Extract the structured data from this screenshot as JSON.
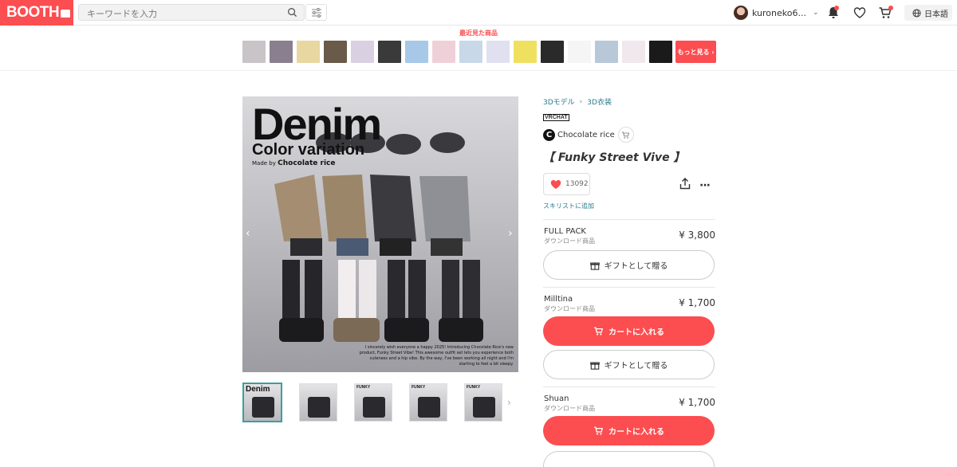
{
  "header": {
    "logo": "BOOTH",
    "search_placeholder": "キーワードを入力",
    "username": "kuroneko6...",
    "language": "日本語"
  },
  "recent": {
    "title": "最近見た商品",
    "more_label": "もっと見る ›",
    "thumb_colors": [
      "#c9c4c8",
      "#8a7f8f",
      "#e8d7a0",
      "#6a5a4a",
      "#d9d0e2",
      "#3a3a3a",
      "#a8c8e8",
      "#f0d0d8",
      "#c8d8e8",
      "#e0e0f0",
      "#f0e060",
      "#2a2a2a",
      "#f5f5f5",
      "#b8c8d8",
      "#f0e8ec",
      "#1a1a1a"
    ]
  },
  "product": {
    "image_title": "Denim",
    "image_subtitle": "Color variation",
    "made_by_prefix": "Made by",
    "made_by_name": "Chocolate rice",
    "image_desc": "I sincerely wish everyone a happy 2025! Introducing Chocolate Rice's new product, Funky Street Vibe! This awesome outfit set lets you experience both cuteness and a hip vibe. By the way, I've been working all night and I'm starting to feel a bit sleepy.",
    "thumb_labels": [
      "Denim",
      "",
      "FUNKY",
      "FUNKY",
      "FUNKY"
    ],
    "breadcrumbs": [
      "3Dモデル",
      "3D衣装"
    ],
    "platform_badge": "VRCHAT",
    "shop_name": "Chocolate rice",
    "title": "【 Funky Street Vive 】",
    "likes": "13092",
    "wishlist_label": "スキリストに追加"
  },
  "variants": [
    {
      "name": "FULL PACK",
      "type": "ダウンロード商品",
      "price": "¥ 3,800",
      "gift_label": "ギフトとして贈る"
    },
    {
      "name": "Milltina",
      "type": "ダウンロード商品",
      "price": "¥ 1,700",
      "cart_label": "カートに入れる",
      "gift_label": "ギフトとして贈る"
    },
    {
      "name": "Shuan",
      "type": "ダウンロード商品",
      "price": "¥ 1,700",
      "cart_label": "カートに入れる"
    }
  ],
  "colors": {
    "brand": "#fc4d50",
    "link": "#2a7a8c"
  }
}
